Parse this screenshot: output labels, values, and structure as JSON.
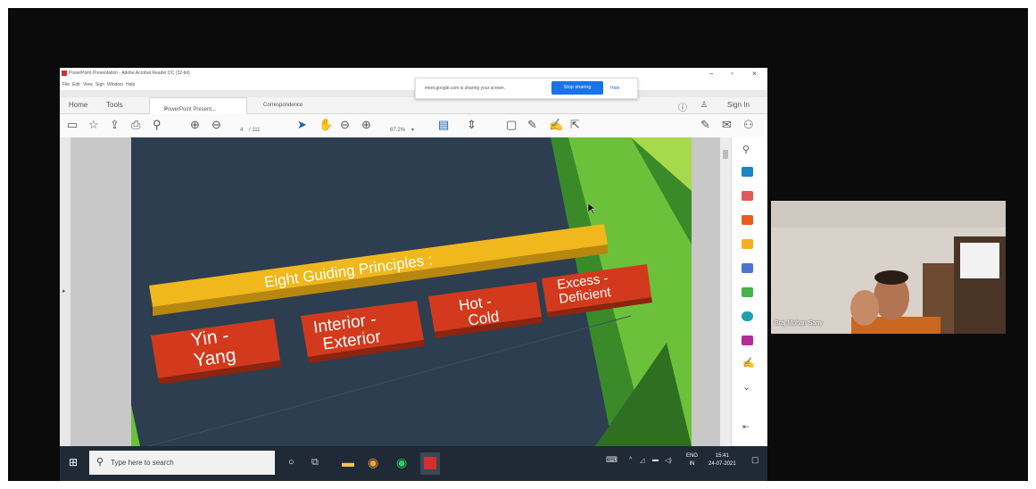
{
  "window": {
    "title": "PowerPoint Presentation - Adobe Acrobat Reader DC (32-bit)",
    "menu": [
      "File",
      "Edit",
      "View",
      "Sign",
      "Window",
      "Help"
    ]
  },
  "share_notice": {
    "message": "meet.google.com is sharing your screen.",
    "stop_label": "Stop sharing",
    "hide_label": "Hide"
  },
  "tabs": {
    "home": "Home",
    "tools": "Tools",
    "doc_tab": "PowerPoint Present...",
    "close": "×",
    "correspondence": "Correspondence",
    "sign_in": "Sign In"
  },
  "toolbar": {
    "page_num": "4",
    "page_total": "/ 111",
    "zoom": "67.2%"
  },
  "slide": {
    "title": "Eight Guiding Principles :",
    "items": [
      "Yin - Yang",
      "Interior - Exterior",
      "Hot - Cold",
      "Excess - Deficient"
    ]
  },
  "taskbar": {
    "search_placeholder": "Type here to search",
    "lang": "ENG",
    "region": "IN",
    "time": "15:41",
    "date": "24-07-2021"
  },
  "webcam": {
    "participant_name": "Braj Mohan Sany"
  },
  "colors": {
    "slide_bg": "#2c3e4f",
    "banner": "#f0b81c",
    "tile": "#d33a1d",
    "green": "#6cc13a",
    "stop_sharing": "#1a73e8"
  }
}
